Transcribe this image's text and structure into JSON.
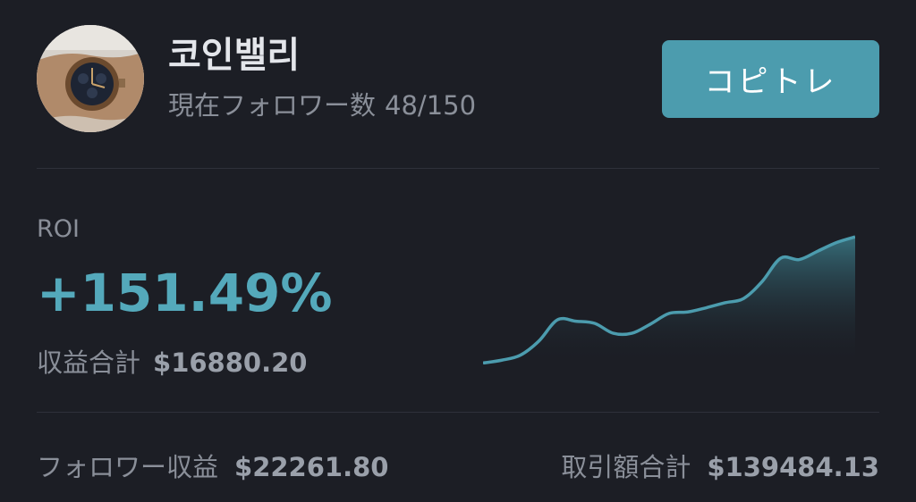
{
  "trader": {
    "name": "코인밸리",
    "followers_label": "現在フォロワー数",
    "followers_count": "48/150",
    "avatar_icon": "watch-photo-avatar"
  },
  "actions": {
    "copy_trade_label": "コピトレ"
  },
  "roi": {
    "label": "ROI",
    "value": "+151.49%",
    "profit_label": "収益合計",
    "profit_value": "$16880.20"
  },
  "stats": {
    "follower_profit_label": "フォロワー収益",
    "follower_profit_value": "$22261.80",
    "trade_volume_label": "取引額合計",
    "trade_volume_value": "$139484.13"
  },
  "colors": {
    "background": "#1c1e25",
    "accent": "#4c9cae",
    "roi_text": "#54a9bb",
    "muted_text": "#8a8f99"
  },
  "chart_data": {
    "type": "area",
    "x": [
      0,
      1,
      2,
      3,
      4,
      5,
      6,
      7,
      8,
      9,
      10,
      11,
      12,
      13,
      14,
      15,
      16,
      17,
      18,
      19,
      20
    ],
    "values": [
      2,
      6,
      13,
      33,
      63,
      61,
      58,
      44,
      44,
      57,
      72,
      74,
      80,
      87,
      93,
      117,
      150,
      148,
      160,
      172,
      180
    ],
    "title": "",
    "xlabel": "",
    "ylabel": "",
    "ylim": [
      0,
      184
    ],
    "grid": false,
    "axes_visible": false
  }
}
